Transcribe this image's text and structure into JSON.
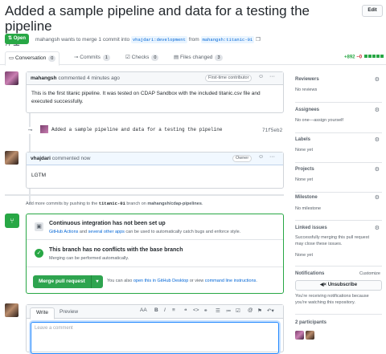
{
  "header": {
    "title": "Added a sample pipeline and data for a testing the pipeline",
    "number": "#1",
    "edit_label": "Edit",
    "state_label": "Open",
    "meta_text": "mahangsh wants to merge 1 commit into",
    "base_branch": "vhajdari:development",
    "from_text": "from",
    "head_branch": "mahangsh:titanic-01"
  },
  "tabs": [
    {
      "label": "Conversation",
      "count": "0"
    },
    {
      "label": "Commits",
      "count": "1"
    },
    {
      "label": "Checks",
      "count": "0"
    },
    {
      "label": "Files changed",
      "count": "3"
    }
  ],
  "diff": {
    "additions": "+892",
    "deletions": "−0"
  },
  "comment1": {
    "author": "mahangsh",
    "action": "commented 4 minutes ago",
    "badge": "First-time contributor",
    "body": "This is the first titanic pipeline. It was tested on CDAP Sandbox with the included titanic.csv file and executed successfully."
  },
  "commit": {
    "message": "Added a sample pipeline and data for a testing the pipeline",
    "sha": "71f5eb2"
  },
  "comment2": {
    "author": "vhajdari",
    "action": "commented now",
    "badge": "Owner",
    "body": "LGTM"
  },
  "push_note": {
    "prefix": "Add more commits by pushing to the",
    "branch": "titanic-01",
    "middle": "branch on",
    "repo": "mahangsh/cdap-pipelines",
    "suffix": "."
  },
  "merge": {
    "ci_title": "Continuous integration has not been set up",
    "ci_link1": "GitHub Actions",
    "ci_and": "and",
    "ci_link2": "several other apps",
    "ci_sub": "can be used to automatically catch bugs and enforce style.",
    "conflict_title": "This branch has no conflicts with the base branch",
    "conflict_sub": "Merging can be performed automatically.",
    "button_label": "Merge pull request",
    "hint_prefix": "You can also",
    "hint_link1": "open this in GitHub Desktop",
    "hint_or": "or view",
    "hint_link2": "command line instructions",
    "hint_suffix": "."
  },
  "editor": {
    "tab_write": "Write",
    "tab_preview": "Preview",
    "placeholder": "Leave a comment"
  },
  "sidebar": {
    "reviewers": {
      "title": "Reviewers",
      "value": "No reviews"
    },
    "assignees": {
      "title": "Assignees",
      "value": "No one—assign yourself"
    },
    "labels": {
      "title": "Labels",
      "value": "None yet"
    },
    "projects": {
      "title": "Projects",
      "value": "None yet"
    },
    "milestone": {
      "title": "Milestone",
      "value": "No milestone"
    },
    "linked": {
      "title": "Linked issues",
      "line1": "Successfully merging this pull request",
      "line2": "may close these issues.",
      "value": "None yet"
    },
    "notifications": {
      "title": "Notifications",
      "customize": "Customize",
      "button": "Unsubscribe",
      "line1": "You're receiving notifications because",
      "line2": "you're watching this repository."
    },
    "participants": {
      "title": "2 participants"
    }
  }
}
